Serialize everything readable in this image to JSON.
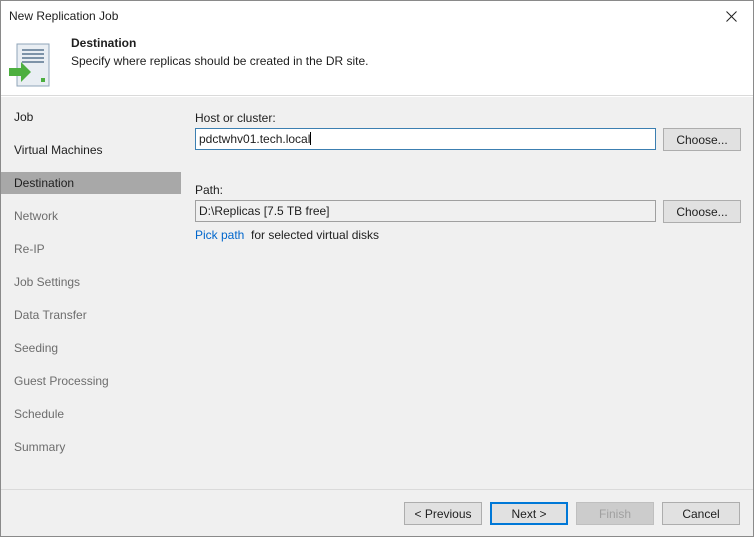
{
  "window": {
    "title": "New Replication Job"
  },
  "header": {
    "title": "Destination",
    "subtitle": "Specify where replicas should be created in the DR site."
  },
  "sidebar": {
    "items": [
      {
        "label": "Job",
        "state": "done"
      },
      {
        "label": "Virtual Machines",
        "state": "done"
      },
      {
        "label": "Destination",
        "state": "active"
      },
      {
        "label": "Network",
        "state": "pending"
      },
      {
        "label": "Re-IP",
        "state": "pending"
      },
      {
        "label": "Job Settings",
        "state": "pending"
      },
      {
        "label": "Data Transfer",
        "state": "pending"
      },
      {
        "label": "Seeding",
        "state": "pending"
      },
      {
        "label": "Guest Processing",
        "state": "pending"
      },
      {
        "label": "Schedule",
        "state": "pending"
      },
      {
        "label": "Summary",
        "state": "pending"
      }
    ]
  },
  "main": {
    "host_label": "Host or cluster:",
    "host_value": "pdctwhv01.tech.local",
    "host_choose": "Choose...",
    "path_label": "Path:",
    "path_value": "D:\\Replicas [7.5 TB free]",
    "path_choose": "Choose...",
    "pick_path_link": "Pick path",
    "pick_path_suffix": "for selected virtual disks"
  },
  "footer": {
    "previous": "< Previous",
    "next": "Next >",
    "finish": "Finish",
    "cancel": "Cancel"
  },
  "colors": {
    "accent": "#0078d7",
    "link": "#0066cc",
    "active_item": "#a8a8a8",
    "panel": "#f0f0f0",
    "icon_green": "#4caf3f"
  }
}
